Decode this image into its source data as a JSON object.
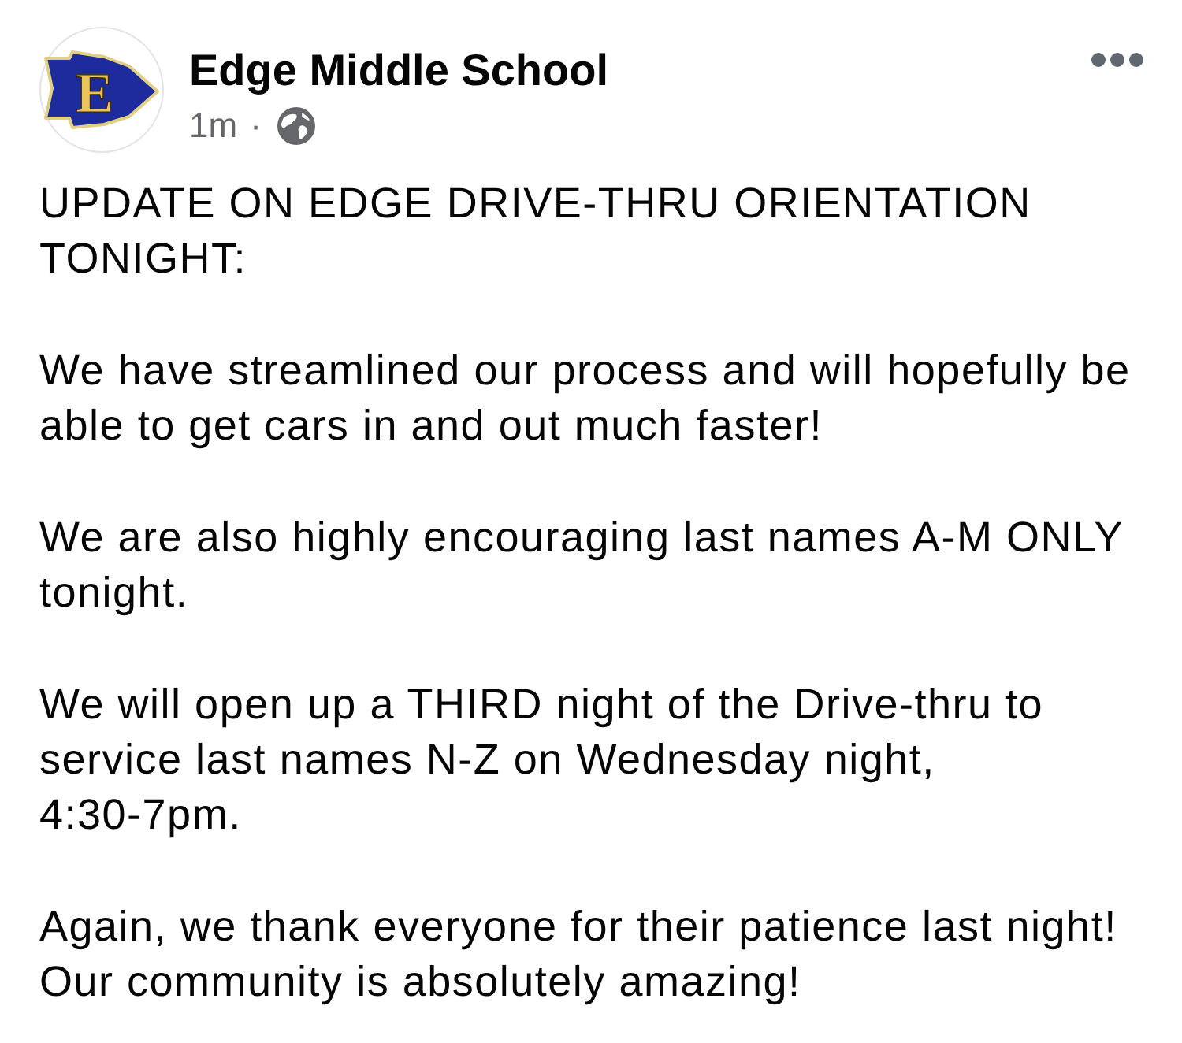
{
  "post": {
    "author": {
      "name": "Edge Middle School",
      "logo_letter": "E"
    },
    "time": "1m",
    "separator": "·",
    "paragraphs": [
      "UPDATE ON EDGE DRIVE-THRU ORIENTATION TONIGHT:",
      "We have streamlined our process and will hopefully be able to get cars in and out much faster!",
      "We are also highly encouraging last names A-M ONLY tonight.",
      "We will open up a THIRD night of the Drive-thru to service last names N-Z on Wednesday night, 4:30-7pm.",
      "Again, we thank everyone for their patience last night! Our community is absolutely amazing!"
    ]
  }
}
